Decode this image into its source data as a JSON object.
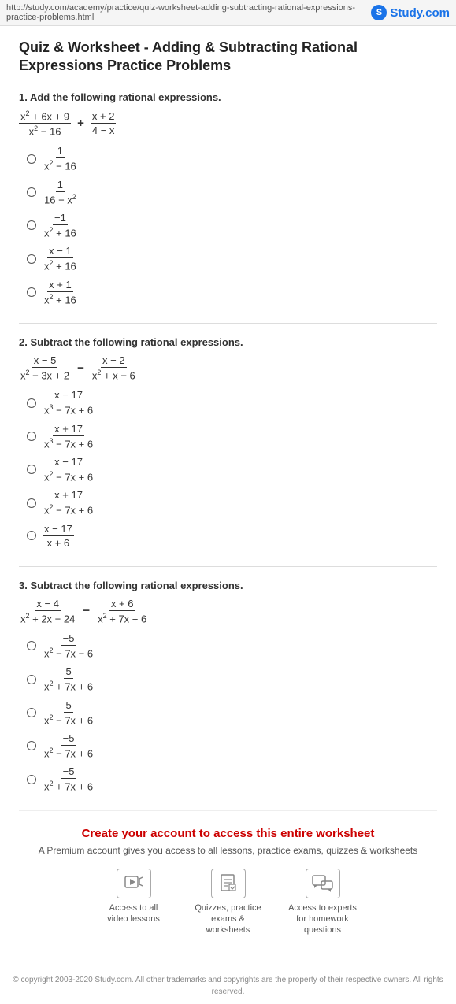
{
  "topbar": {
    "url": "http://study.com/academy/practice/quiz-worksheet-adding-subtracting-rational-expressions-practice-problems.html",
    "logo_text": "Study.com",
    "logo_initial": "S"
  },
  "page": {
    "title": "Quiz & Worksheet - Adding & Subtracting Rational Expressions Practice Problems"
  },
  "questions": [
    {
      "id": "q1",
      "label": "1. Add the following rational expressions.",
      "expression_html": "q1_expr",
      "options": [
        {
          "id": "q1a",
          "html": "q1o1"
        },
        {
          "id": "q1b",
          "html": "q1o2"
        },
        {
          "id": "q1c",
          "html": "q1o3"
        },
        {
          "id": "q1d",
          "html": "q1o4"
        },
        {
          "id": "q1e",
          "html": "q1o5"
        }
      ]
    },
    {
      "id": "q2",
      "label": "2. Subtract the following rational expressions.",
      "options": [
        {
          "id": "q2a"
        },
        {
          "id": "q2b"
        },
        {
          "id": "q2c"
        },
        {
          "id": "q2d"
        },
        {
          "id": "q2e"
        }
      ]
    },
    {
      "id": "q3",
      "label": "3. Subtract the following rational expressions.",
      "options": []
    }
  ],
  "cta": {
    "title": "Create your account to access this entire worksheet",
    "subtitle": "A Premium account gives you access to all lessons, practice exams, quizzes & worksheets",
    "icons": [
      {
        "label": "Access to all video lessons",
        "icon": "▶"
      },
      {
        "label": "Quizzes, practice exams & worksheets",
        "icon": "📋"
      },
      {
        "label": "Access to experts for homework questions",
        "icon": "💬"
      }
    ]
  },
  "footer": {
    "text": "© copyright 2003-2020 Study.com. All other trademarks and copyrights are the property of their respective owners. All rights reserved."
  }
}
